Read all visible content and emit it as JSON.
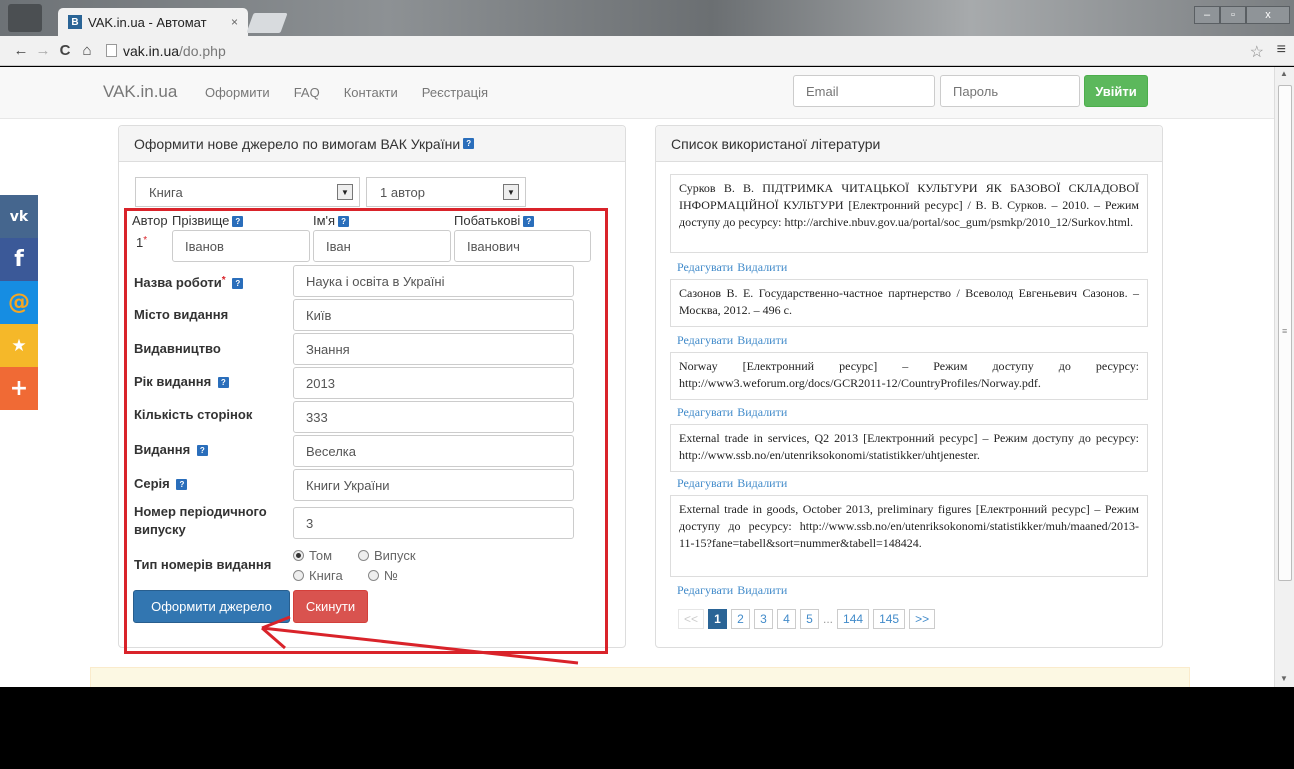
{
  "browser": {
    "tab_title": "VAK.in.ua - Автомат",
    "tab_favicon": "B",
    "tab_close": "×",
    "url_host": "vak.in.ua",
    "url_path": "/do.php",
    "win_min": "–",
    "win_max": "▫",
    "win_close": "x"
  },
  "navbar": {
    "brand": "VAK.in.ua",
    "links": [
      "Оформити",
      "FAQ",
      "Контакти",
      "Реєстрація"
    ],
    "email_placeholder": "Email",
    "password_placeholder": "Пароль",
    "login_label": "Увійти"
  },
  "social": [
    "vk",
    "f",
    "@",
    "★",
    "+"
  ],
  "form": {
    "title": "Оформити нове джерело по вимогам ВАК України",
    "help": "?",
    "source_type": "Книга",
    "authors_count": "1 автор",
    "author_label": "Автор",
    "surname_label": "Прізвище",
    "name_label": "Ім'я",
    "patronymic_label": "Побатькові",
    "author_index": "1",
    "req": "*",
    "surname": "Іванов",
    "name": "Іван",
    "patronymic": "Іванович",
    "work_title_label": "Назва роботи",
    "work_title": "Наука і освіта в Україні",
    "city_label": "Місто видання",
    "city": "Київ",
    "publisher_label": "Видавництво",
    "publisher": "Знання",
    "year_label": "Рік видання",
    "year": "2013",
    "pages_label": "Кількість сторінок",
    "pages": "333",
    "edition_label": "Видання",
    "edition": "Веселка",
    "series_label": "Серія",
    "series": "Книги України",
    "issue_label_1": "Номер періодичного",
    "issue_label_2": "випуску",
    "issue": "3",
    "type_label": "Тип номерів видання",
    "radio_tom": "Том",
    "radio_vypusk": "Випуск",
    "radio_knyha": "Книга",
    "radio_no": "№",
    "submit_label": "Оформити джерело",
    "reset_label": "Скинути"
  },
  "list": {
    "title": "Список використаної літератури",
    "items": [
      "Сурков В. В. ПІДТРИМКА ЧИТАЦЬКОЇ КУЛЬТУРИ ЯК БАЗОВОЇ СКЛАДОВОЇ ІНФОРМАЦІЙНОЇ КУЛЬТУРИ [Електронний ресурс] / В. В. Сурков. – 2010. – Режим доступу до ресурсу: http://archive.nbuv.gov.ua/portal/soc_gum/psmkp/2010_12/Surkov.html.",
      "Сазонов В. Е. Государственно-частное партнерство / Всеволод Евгеньевич Сазонов. – Москва, 2012. – 496 с.",
      "Norway [Електронний ресурс] – Режим доступу до ресурсу: http://www3.weforum.org/docs/GCR2011-12/CountryProfiles/Norway.pdf.",
      "External trade in services, Q2 2013 [Електронний ресурс] – Режим доступу до ресурсу: http://www.ssb.no/en/utenriksokonomi/statistikker/uhtjenester.",
      "External trade in goods, October 2013, preliminary figures [Електронний ресурс] – Режим доступу до ресурсу: http://www.ssb.no/en/utenriksokonomi/statistikker/muh/maaned/2013-11-15?fane=tabell&sort=nummer&tabell=148424."
    ],
    "edit_label": "Редагувати",
    "delete_label": "Видалити",
    "pages": [
      "<<",
      "1",
      "2",
      "3",
      "4",
      "5",
      "...",
      "144",
      "145",
      ">>"
    ]
  },
  "colors": {
    "highlight": "#d9232a",
    "primary": "#3276b1",
    "danger": "#d9534f",
    "success": "#5cb85c"
  }
}
